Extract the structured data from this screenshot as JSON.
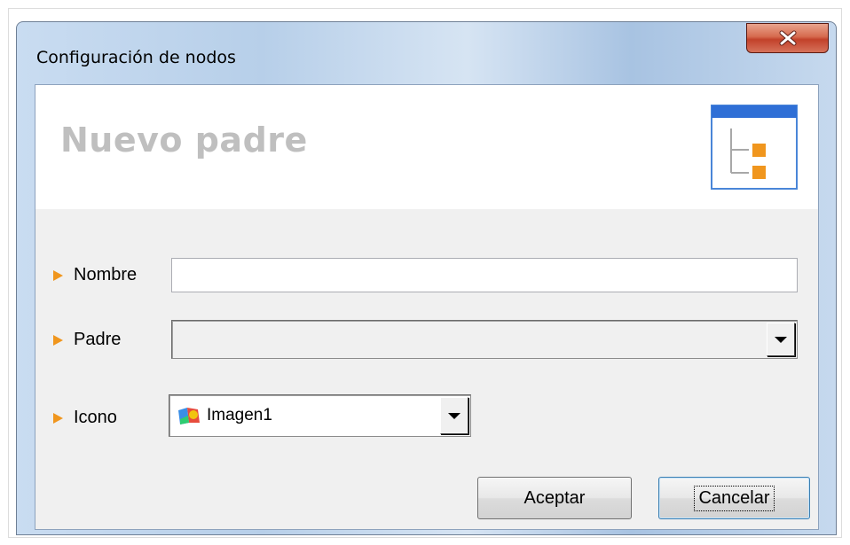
{
  "window": {
    "title": "Configuración de nodos",
    "close_icon": "close-icon"
  },
  "header": {
    "title": "Nuevo padre",
    "icon": "tree-icon"
  },
  "form": {
    "nombre": {
      "label": "Nombre",
      "value": "",
      "placeholder": ""
    },
    "padre": {
      "label": "Padre",
      "selected": ""
    },
    "icono": {
      "label": "Icono",
      "selected": "Imagen1",
      "icon": "image-icon"
    }
  },
  "buttons": {
    "accept_label": "Aceptar",
    "cancel_label": "Cancelar"
  },
  "colors": {
    "accent_bullet": "#f0961e",
    "header_title": "#bfbfbf",
    "close_button": "#c2412a"
  }
}
